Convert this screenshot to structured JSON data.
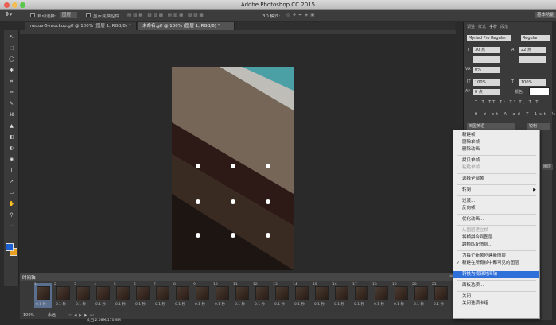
{
  "window": {
    "title": "Adobe Photoshop CC 2015"
  },
  "options_bar": {
    "auto_select_label": "自动选择:",
    "auto_select_value": "图层",
    "transform_label": "显示变换控件",
    "mode_label": "3D 模式:",
    "workspace": "基本功能"
  },
  "doc_tabs": [
    {
      "label": "nexus-5-mockup.gif @ 100% (图层 1, RGB/8) *"
    },
    {
      "label": "未命名.gif @ 100% (图层 1, RGB/8) *"
    }
  ],
  "tools": [
    "↖",
    "⬚",
    "◯",
    "✱",
    "⌗",
    "✂",
    "✎",
    "⌘",
    "▲",
    "◧",
    "◐",
    "◉",
    "T",
    "↗",
    "▭",
    "✋",
    "⚲",
    "⋯"
  ],
  "timeline": {
    "title": "时间轴",
    "loop": "永远",
    "frames": [
      {
        "n": "1",
        "t": "0.1 秒"
      },
      {
        "n": "2",
        "t": "0.1 秒"
      },
      {
        "n": "3",
        "t": "0.1 秒"
      },
      {
        "n": "4",
        "t": "0.1 秒"
      },
      {
        "n": "5",
        "t": "0.1 秒"
      },
      {
        "n": "6",
        "t": "0.1 秒"
      },
      {
        "n": "7",
        "t": "0.1 秒"
      },
      {
        "n": "8",
        "t": "0.1 秒"
      },
      {
        "n": "9",
        "t": "0.1 秒"
      },
      {
        "n": "10",
        "t": "0.1 秒"
      },
      {
        "n": "11",
        "t": "0.1 秒"
      },
      {
        "n": "12",
        "t": "0.1 秒"
      },
      {
        "n": "13",
        "t": "0.1 秒"
      },
      {
        "n": "14",
        "t": "0.1 秒"
      },
      {
        "n": "15",
        "t": "0.1 秒"
      },
      {
        "n": "16",
        "t": "0.1 秒"
      },
      {
        "n": "17",
        "t": "0.1 秒"
      },
      {
        "n": "18",
        "t": "0.1 秒"
      },
      {
        "n": "19",
        "t": "0.1 秒"
      },
      {
        "n": "20",
        "t": "0.1 秒"
      },
      {
        "n": "21",
        "t": "0.1 秒"
      }
    ]
  },
  "status": {
    "zoom": "100%",
    "doc": "文档:2.08M/170.8M"
  },
  "right_panel": {
    "tabs": [
      "调整",
      "样式",
      "字符",
      "段落"
    ],
    "font_family": "Myriad Pro",
    "font_style": "Regular",
    "font_size": "30 点",
    "leading": "22 点",
    "tracking": "0%",
    "vscale": "100%",
    "hscale": "100%",
    "baseline": "0 点",
    "color_label": "颜色:",
    "language": "美国英语",
    "aa_label": "锐利",
    "layer_label": "图层 1"
  },
  "context_menu": [
    {
      "label": "新建帧",
      "disabled": false
    },
    {
      "label": "删除单帧",
      "disabled": false
    },
    {
      "label": "删除动画",
      "disabled": false
    },
    {
      "sep": true
    },
    {
      "label": "拷贝单帧",
      "disabled": false
    },
    {
      "label": "粘贴单帧...",
      "disabled": true
    },
    {
      "sep": true
    },
    {
      "label": "选择全部帧",
      "disabled": false
    },
    {
      "sep": true
    },
    {
      "label": "转到",
      "disabled": false,
      "submenu": true
    },
    {
      "sep": true
    },
    {
      "label": "过渡...",
      "disabled": false
    },
    {
      "label": "反向帧",
      "disabled": false
    },
    {
      "sep": true
    },
    {
      "label": "优化动画...",
      "disabled": false
    },
    {
      "sep": true
    },
    {
      "label": "从图层建立帧",
      "disabled": true
    },
    {
      "label": "将帧拼合到图层",
      "disabled": false
    },
    {
      "label": "跨帧匹配图层...",
      "disabled": false
    },
    {
      "sep": true
    },
    {
      "label": "为每个新帧创建新图层",
      "disabled": false
    },
    {
      "label": "新建在所有帧中都可见的图层",
      "disabled": false,
      "checked": true
    },
    {
      "sep": true
    },
    {
      "label": "转换为视频时间轴",
      "disabled": false,
      "highlight": true
    },
    {
      "sep": true
    },
    {
      "label": "面板选项...",
      "disabled": false
    },
    {
      "sep": true
    },
    {
      "label": "关闭",
      "disabled": false
    },
    {
      "label": "关闭选项卡组",
      "disabled": false
    }
  ],
  "colors": {
    "accent": "#2e6fd9",
    "fg_swatch": "#1e5fd0",
    "bg_swatch": "#e8a020",
    "teal": "#4aa0a4"
  }
}
